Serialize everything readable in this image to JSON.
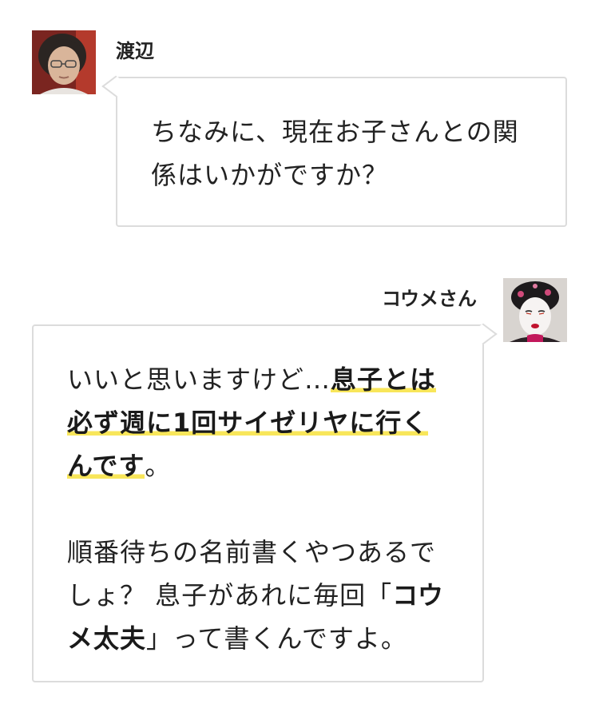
{
  "messages": [
    {
      "speaker": "渡辺",
      "avatar_icon": "person-glasses-avatar",
      "side": "left",
      "text": "ちなみに、現在お子さんとの関係はいかがですか？"
    },
    {
      "speaker": "コウメさん",
      "avatar_icon": "white-makeup-avatar",
      "side": "right",
      "paragraphs": [
        {
          "segments": [
            {
              "text": "いいと思いますけど…",
              "bold": false,
              "highlight": false
            },
            {
              "text": "息子とは必ず週に1回サイゼリヤに行くんです",
              "bold": true,
              "highlight": true
            },
            {
              "text": "。",
              "bold": false,
              "highlight": false
            }
          ]
        },
        {
          "segments": [
            {
              "text": "順番待ちの名前書くやつあるでしょ？ 息子があれに毎回「",
              "bold": false,
              "highlight": false
            },
            {
              "text": "コウメ太夫",
              "bold": true,
              "highlight": false
            },
            {
              "text": "」って書くんですよ。",
              "bold": false,
              "highlight": false
            }
          ]
        }
      ]
    }
  ],
  "colors": {
    "highlight": "#f8e65a",
    "bubble_border": "#dcdcdc",
    "text": "#222222"
  }
}
